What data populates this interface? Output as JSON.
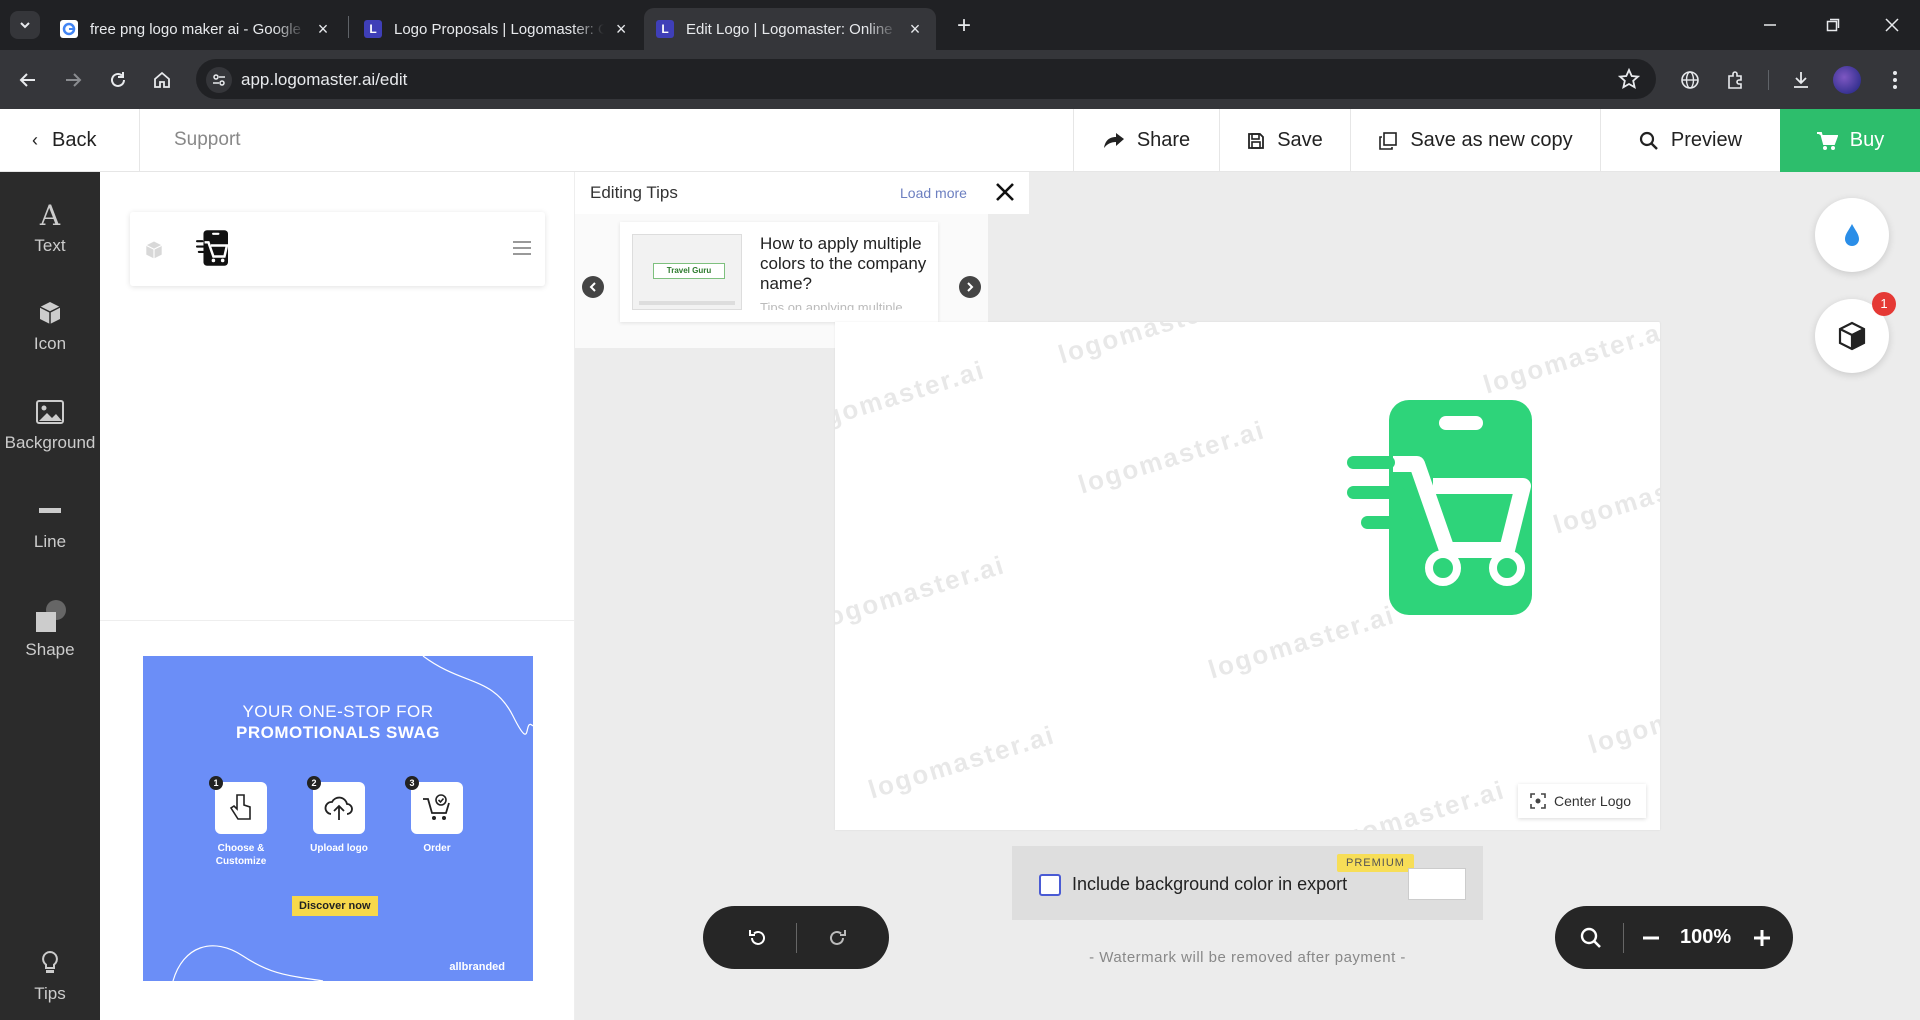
{
  "browser": {
    "tabs": [
      {
        "title": "free png logo maker ai - Google Search",
        "favicon": "google-icon"
      },
      {
        "title": "Logo Proposals | Logomaster: Online Logo Maker",
        "favicon": "L"
      },
      {
        "title": "Edit Logo | Logomaster: Online Logo Maker",
        "favicon": "L"
      }
    ],
    "url": "app.logomaster.ai/edit"
  },
  "header": {
    "back": "Back",
    "support": "Support",
    "share": "Share",
    "save": "Save",
    "save_copy": "Save as new copy",
    "preview": "Preview",
    "buy": "Buy"
  },
  "rail": {
    "text": "Text",
    "icon": "Icon",
    "background": "Background",
    "line": "Line",
    "shape": "Shape",
    "tips": "Tips"
  },
  "tips": {
    "title": "Editing Tips",
    "load_more": "Load more",
    "card_title": "How to apply multiple colors to the company name?",
    "card_sub": "Tips on applying multiple colors",
    "thumb_label": "Travel Guru"
  },
  "ad": {
    "line1": "YOUR ONE-STOP FOR",
    "line2": "PROMOTIONALS SWAG",
    "steps": [
      {
        "num": "1",
        "label": "Choose & Customize"
      },
      {
        "num": "2",
        "label": "Upload logo"
      },
      {
        "num": "3",
        "label": "Order"
      }
    ],
    "cta": "Discover now",
    "brand": "allbranded"
  },
  "canvas": {
    "watermark": "logomaster.ai",
    "center_logo": "Center Logo",
    "logo_color": "#2ed47a"
  },
  "export": {
    "label": "Include background color in export",
    "premium": "PREMIUM",
    "note": "- Watermark will be removed after payment -"
  },
  "zoom": {
    "value": "100%"
  },
  "notifications": {
    "badge": "1"
  },
  "colors": {
    "accent_green": "#2dbe6c",
    "rail_bg": "#2b2b2b",
    "ad_bg": "#6b8ef7"
  }
}
